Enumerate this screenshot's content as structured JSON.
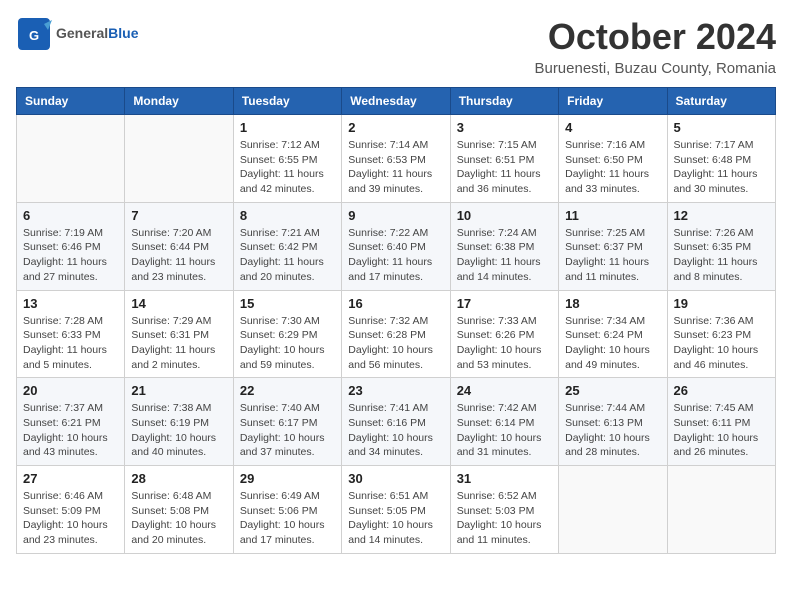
{
  "logo": {
    "general": "General",
    "blue": "Blue",
    "tagline": "GeneralBlue"
  },
  "header": {
    "month_title": "October 2024",
    "subtitle": "Buruenesti, Buzau County, Romania"
  },
  "weekdays": [
    "Sunday",
    "Monday",
    "Tuesday",
    "Wednesday",
    "Thursday",
    "Friday",
    "Saturday"
  ],
  "weeks": [
    [
      {
        "day": "",
        "sunrise": "",
        "sunset": "",
        "daylight": ""
      },
      {
        "day": "",
        "sunrise": "",
        "sunset": "",
        "daylight": ""
      },
      {
        "day": "1",
        "sunrise": "Sunrise: 7:12 AM",
        "sunset": "Sunset: 6:55 PM",
        "daylight": "Daylight: 11 hours and 42 minutes."
      },
      {
        "day": "2",
        "sunrise": "Sunrise: 7:14 AM",
        "sunset": "Sunset: 6:53 PM",
        "daylight": "Daylight: 11 hours and 39 minutes."
      },
      {
        "day": "3",
        "sunrise": "Sunrise: 7:15 AM",
        "sunset": "Sunset: 6:51 PM",
        "daylight": "Daylight: 11 hours and 36 minutes."
      },
      {
        "day": "4",
        "sunrise": "Sunrise: 7:16 AM",
        "sunset": "Sunset: 6:50 PM",
        "daylight": "Daylight: 11 hours and 33 minutes."
      },
      {
        "day": "5",
        "sunrise": "Sunrise: 7:17 AM",
        "sunset": "Sunset: 6:48 PM",
        "daylight": "Daylight: 11 hours and 30 minutes."
      }
    ],
    [
      {
        "day": "6",
        "sunrise": "Sunrise: 7:19 AM",
        "sunset": "Sunset: 6:46 PM",
        "daylight": "Daylight: 11 hours and 27 minutes."
      },
      {
        "day": "7",
        "sunrise": "Sunrise: 7:20 AM",
        "sunset": "Sunset: 6:44 PM",
        "daylight": "Daylight: 11 hours and 23 minutes."
      },
      {
        "day": "8",
        "sunrise": "Sunrise: 7:21 AM",
        "sunset": "Sunset: 6:42 PM",
        "daylight": "Daylight: 11 hours and 20 minutes."
      },
      {
        "day": "9",
        "sunrise": "Sunrise: 7:22 AM",
        "sunset": "Sunset: 6:40 PM",
        "daylight": "Daylight: 11 hours and 17 minutes."
      },
      {
        "day": "10",
        "sunrise": "Sunrise: 7:24 AM",
        "sunset": "Sunset: 6:38 PM",
        "daylight": "Daylight: 11 hours and 14 minutes."
      },
      {
        "day": "11",
        "sunrise": "Sunrise: 7:25 AM",
        "sunset": "Sunset: 6:37 PM",
        "daylight": "Daylight: 11 hours and 11 minutes."
      },
      {
        "day": "12",
        "sunrise": "Sunrise: 7:26 AM",
        "sunset": "Sunset: 6:35 PM",
        "daylight": "Daylight: 11 hours and 8 minutes."
      }
    ],
    [
      {
        "day": "13",
        "sunrise": "Sunrise: 7:28 AM",
        "sunset": "Sunset: 6:33 PM",
        "daylight": "Daylight: 11 hours and 5 minutes."
      },
      {
        "day": "14",
        "sunrise": "Sunrise: 7:29 AM",
        "sunset": "Sunset: 6:31 PM",
        "daylight": "Daylight: 11 hours and 2 minutes."
      },
      {
        "day": "15",
        "sunrise": "Sunrise: 7:30 AM",
        "sunset": "Sunset: 6:29 PM",
        "daylight": "Daylight: 10 hours and 59 minutes."
      },
      {
        "day": "16",
        "sunrise": "Sunrise: 7:32 AM",
        "sunset": "Sunset: 6:28 PM",
        "daylight": "Daylight: 10 hours and 56 minutes."
      },
      {
        "day": "17",
        "sunrise": "Sunrise: 7:33 AM",
        "sunset": "Sunset: 6:26 PM",
        "daylight": "Daylight: 10 hours and 53 minutes."
      },
      {
        "day": "18",
        "sunrise": "Sunrise: 7:34 AM",
        "sunset": "Sunset: 6:24 PM",
        "daylight": "Daylight: 10 hours and 49 minutes."
      },
      {
        "day": "19",
        "sunrise": "Sunrise: 7:36 AM",
        "sunset": "Sunset: 6:23 PM",
        "daylight": "Daylight: 10 hours and 46 minutes."
      }
    ],
    [
      {
        "day": "20",
        "sunrise": "Sunrise: 7:37 AM",
        "sunset": "Sunset: 6:21 PM",
        "daylight": "Daylight: 10 hours and 43 minutes."
      },
      {
        "day": "21",
        "sunrise": "Sunrise: 7:38 AM",
        "sunset": "Sunset: 6:19 PM",
        "daylight": "Daylight: 10 hours and 40 minutes."
      },
      {
        "day": "22",
        "sunrise": "Sunrise: 7:40 AM",
        "sunset": "Sunset: 6:17 PM",
        "daylight": "Daylight: 10 hours and 37 minutes."
      },
      {
        "day": "23",
        "sunrise": "Sunrise: 7:41 AM",
        "sunset": "Sunset: 6:16 PM",
        "daylight": "Daylight: 10 hours and 34 minutes."
      },
      {
        "day": "24",
        "sunrise": "Sunrise: 7:42 AM",
        "sunset": "Sunset: 6:14 PM",
        "daylight": "Daylight: 10 hours and 31 minutes."
      },
      {
        "day": "25",
        "sunrise": "Sunrise: 7:44 AM",
        "sunset": "Sunset: 6:13 PM",
        "daylight": "Daylight: 10 hours and 28 minutes."
      },
      {
        "day": "26",
        "sunrise": "Sunrise: 7:45 AM",
        "sunset": "Sunset: 6:11 PM",
        "daylight": "Daylight: 10 hours and 26 minutes."
      }
    ],
    [
      {
        "day": "27",
        "sunrise": "Sunrise: 6:46 AM",
        "sunset": "Sunset: 5:09 PM",
        "daylight": "Daylight: 10 hours and 23 minutes."
      },
      {
        "day": "28",
        "sunrise": "Sunrise: 6:48 AM",
        "sunset": "Sunset: 5:08 PM",
        "daylight": "Daylight: 10 hours and 20 minutes."
      },
      {
        "day": "29",
        "sunrise": "Sunrise: 6:49 AM",
        "sunset": "Sunset: 5:06 PM",
        "daylight": "Daylight: 10 hours and 17 minutes."
      },
      {
        "day": "30",
        "sunrise": "Sunrise: 6:51 AM",
        "sunset": "Sunset: 5:05 PM",
        "daylight": "Daylight: 10 hours and 14 minutes."
      },
      {
        "day": "31",
        "sunrise": "Sunrise: 6:52 AM",
        "sunset": "Sunset: 5:03 PM",
        "daylight": "Daylight: 10 hours and 11 minutes."
      },
      {
        "day": "",
        "sunrise": "",
        "sunset": "",
        "daylight": ""
      },
      {
        "day": "",
        "sunrise": "",
        "sunset": "",
        "daylight": ""
      }
    ]
  ]
}
